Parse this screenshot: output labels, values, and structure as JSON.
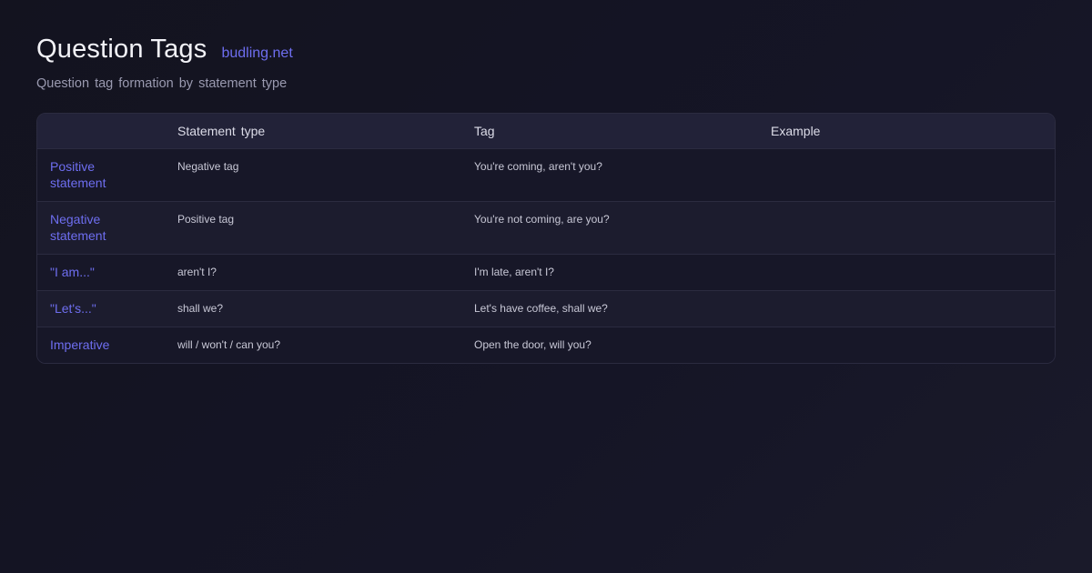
{
  "header": {
    "title": "Question Tags",
    "brand": "budling.net",
    "subtitle": "Question tag formation by statement type"
  },
  "table": {
    "columns": [
      "",
      "Statement type",
      "Tag",
      "Example"
    ],
    "rows": [
      {
        "label": "Positive statement",
        "statement_type": "Negative tag",
        "tag": "You're coming, aren't you?",
        "example": ""
      },
      {
        "label": "Negative statement",
        "statement_type": "Positive tag",
        "tag": "You're not coming, are you?",
        "example": ""
      },
      {
        "label": "\"I am...\"",
        "statement_type": "aren't I?",
        "tag": "I'm late, aren't I?",
        "example": ""
      },
      {
        "label": "\"Let's...\"",
        "statement_type": "shall we?",
        "tag": "Let's have coffee, shall we?",
        "example": ""
      },
      {
        "label": "Imperative",
        "statement_type": "will / won't / can you?",
        "tag": "Open the door, will you?",
        "example": ""
      }
    ]
  },
  "colors": {
    "accent": "#6e6ef0",
    "background": "#13131f",
    "header_row": "#222238"
  }
}
